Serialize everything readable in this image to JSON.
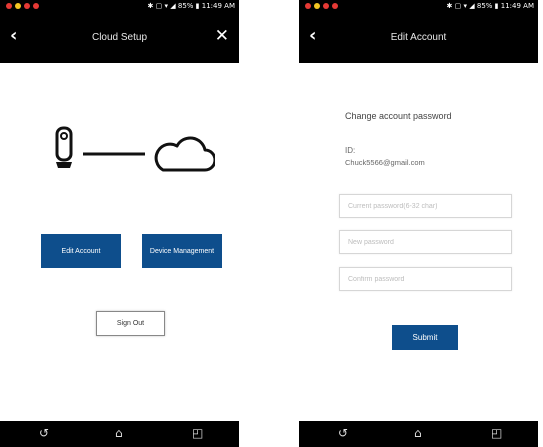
{
  "colors": {
    "bar": "#000000",
    "primary": "#0e4e8c",
    "dot_red": "#e53935",
    "dot_yellow": "#f3c623"
  },
  "status_bar": {
    "time": "11:49 AM",
    "battery": "85%",
    "icons": [
      "notification-dot-red",
      "notification-dot-yellow",
      "notification-dot-red",
      "notification-dot-red",
      "bluetooth-icon",
      "nfc-icon",
      "wifi-icon",
      "signal-icon",
      "battery-icon"
    ]
  },
  "cloud_setup": {
    "title": "Cloud Setup",
    "illustration": [
      "camera-icon",
      "connection-line",
      "cloud-icon"
    ],
    "edit_account_label": "Edit Account",
    "device_management_label": "Device Management",
    "sign_out_label": "Sign Out"
  },
  "edit_account": {
    "title": "Edit Account",
    "heading": "Change account password",
    "id_label": "ID:",
    "id_value": "Chuck5566@gmail.com",
    "current_password_placeholder": "Current password(6-32 char)",
    "new_password_placeholder": "New password",
    "confirm_password_placeholder": "Confirm password",
    "submit_label": "Submit"
  },
  "nav_bar": {
    "back": "back-icon",
    "home": "home-icon",
    "recents": "recents-icon"
  }
}
